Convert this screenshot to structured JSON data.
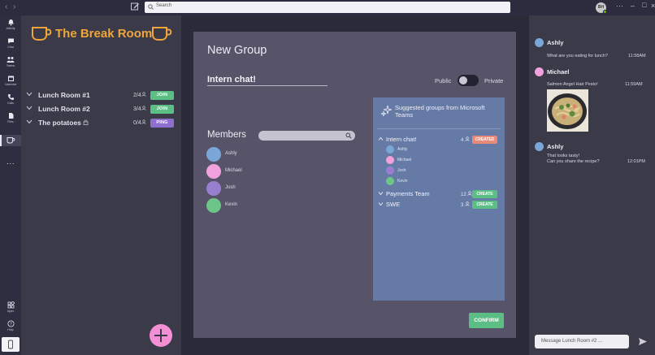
{
  "search": {
    "placeholder": "Search"
  },
  "user": {
    "initials": "BH"
  },
  "colors": {
    "brand": "#f0a53b",
    "join": "#5bbf85",
    "ping": "#8e6ecf",
    "created": "#e88a7a",
    "fab": "#f48fd5",
    "suggest_panel": "#667aa6"
  },
  "rail": {
    "items": [
      {
        "label": "Activity",
        "icon": "bell-icon"
      },
      {
        "label": "Chat",
        "icon": "chat-icon"
      },
      {
        "label": "Teams",
        "icon": "teams-icon"
      },
      {
        "label": "Calendar",
        "icon": "calendar-icon"
      },
      {
        "label": "Calls",
        "icon": "phone-icon"
      },
      {
        "label": "Files",
        "icon": "file-icon"
      },
      {
        "label": "",
        "icon": "mug-icon"
      },
      {
        "label": "",
        "icon": "more-icon"
      }
    ],
    "bottom": [
      {
        "label": "Apps",
        "icon": "apps-icon"
      },
      {
        "label": "Help",
        "icon": "help-icon"
      }
    ]
  },
  "sidebar": {
    "brand_title": "The Break Room",
    "rooms": [
      {
        "name": "Lunch Room #1",
        "count": "2/4",
        "action": "JOIN"
      },
      {
        "name": "Lunch Room #2",
        "count": "3/4",
        "action": "JOIN"
      },
      {
        "name": "The potatoes",
        "count": "0/4",
        "action": "PING",
        "locked": true
      }
    ]
  },
  "dialog": {
    "title": "New Group",
    "group_name": "Intern chat!",
    "public_label": "Public",
    "private_label": "Private",
    "members_title": "Members",
    "members": [
      {
        "name": "Ashly",
        "color": "#7aa6d8"
      },
      {
        "name": "Michael",
        "color": "#f1a1dc"
      },
      {
        "name": "Josh",
        "color": "#9a7fd1"
      },
      {
        "name": "Kevin",
        "color": "#6dc58a"
      }
    ],
    "suggested": {
      "title": "Suggested groups from Microsoft Teams",
      "groups": [
        {
          "name": "Intern chat!",
          "count": "4",
          "action": "CREATED",
          "members": [
            {
              "name": "Ashly",
              "color": "#7aa6d8"
            },
            {
              "name": "Michael",
              "color": "#f1a1dc"
            },
            {
              "name": "Josh",
              "color": "#9a7fd1"
            },
            {
              "name": "Kevin",
              "color": "#6dc58a"
            }
          ]
        },
        {
          "name": "Payments Team",
          "count": "12",
          "action": "CREATE"
        },
        {
          "name": "SWE",
          "count": "3",
          "action": "CREATE"
        }
      ]
    },
    "confirm_label": "CONFIRM"
  },
  "chat": {
    "messages": [
      {
        "author": "Ashly",
        "color": "#7aa6d8",
        "lines": [
          "What are you eating for lunch?"
        ],
        "time": "11:58AM"
      },
      {
        "author": "Michael",
        "color": "#f1a1dc",
        "lines": [
          "Salmon Angel Hair Pesto!"
        ],
        "time": "11:59AM",
        "image": "pasta-photo"
      },
      {
        "author": "Ashly",
        "color": "#7aa6d8",
        "lines": [
          "That looks tasty!",
          "Can you share the recipe?"
        ],
        "time": "12:01PM"
      }
    ],
    "compose_placeholder": "Message Lunch Room #2 ..."
  }
}
